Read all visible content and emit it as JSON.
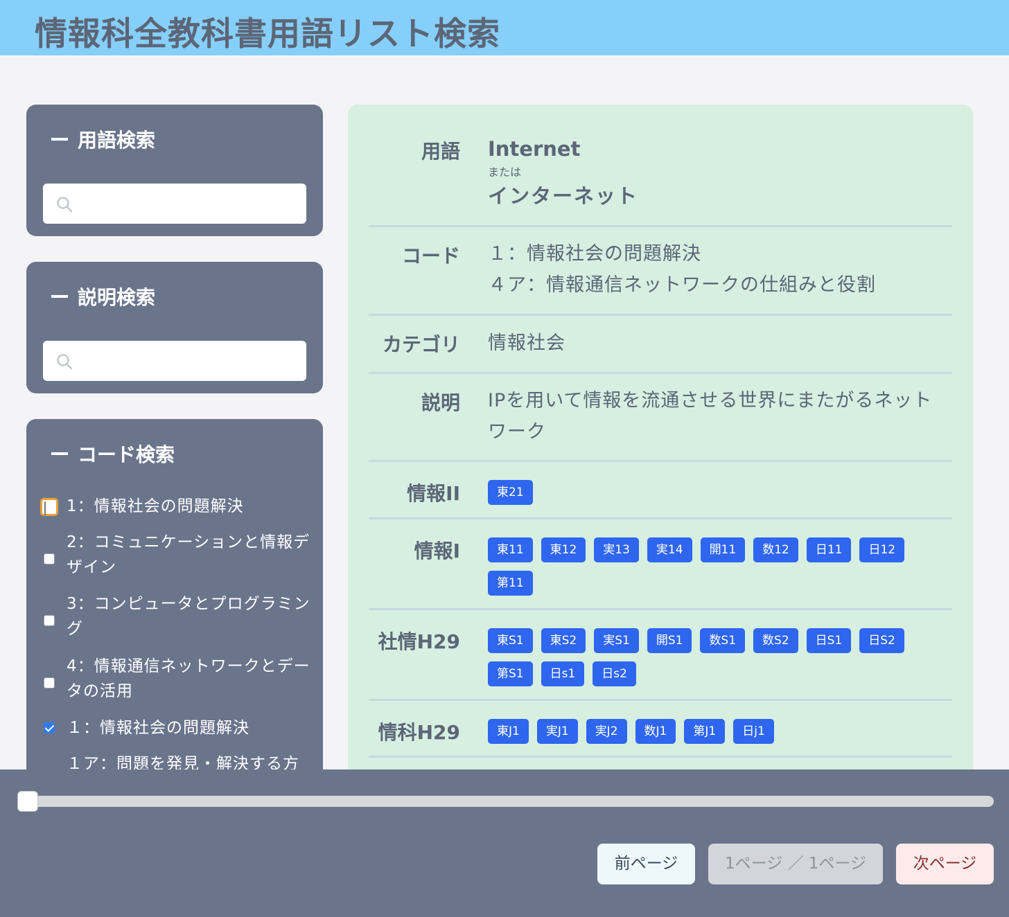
{
  "header": {
    "title": "情報科全教科書用語リスト検索"
  },
  "sidebar": {
    "term_search": {
      "title": "用語検索",
      "placeholder": ""
    },
    "desc_search": {
      "title": "説明検索",
      "placeholder": ""
    },
    "code_search": {
      "title": "コード検索",
      "items": [
        {
          "label": "1：情報社会の問題解決",
          "checked": false,
          "focused": true
        },
        {
          "label": "2：コミュニケーションと情報デザイン",
          "checked": false
        },
        {
          "label": "3：コンピュータとプログラミング",
          "checked": false
        },
        {
          "label": "4：情報通信ネットワークとデータの活用",
          "checked": false
        },
        {
          "label": "１：情報社会の問題解決",
          "checked": true
        },
        {
          "label": "１ア：問題を発見・解決する方",
          "checked": false
        }
      ]
    }
  },
  "detail": {
    "term": {
      "label": "用語",
      "primary": "Internet",
      "or": "または",
      "secondary": "インターネット"
    },
    "code": {
      "label": "コード",
      "lines": [
        "１：情報社会の問題解決",
        "４ア：情報通信ネットワークの仕組みと役割"
      ]
    },
    "category": {
      "label": "カテゴリ",
      "value": "情報社会"
    },
    "description": {
      "label": "説明",
      "value": "IPを用いて情報を流通させる世界にまたがるネットワーク"
    },
    "joho2": {
      "label": "情報II",
      "tags": [
        "東21"
      ]
    },
    "joho1": {
      "label": "情報I",
      "tags": [
        "東11",
        "東12",
        "実13",
        "実14",
        "開11",
        "数12",
        "日11",
        "日12",
        "第11"
      ]
    },
    "shajo": {
      "label": "社情H29",
      "tags": [
        "東S1",
        "東S2",
        "実S1",
        "開S1",
        "数S1",
        "数S2",
        "日S1",
        "日S2",
        "第S1",
        "日s1",
        "日s2"
      ]
    },
    "joka": {
      "label": "情科H29",
      "tags": [
        "東J1",
        "実J1",
        "実J2",
        "数J1",
        "第J1",
        "日j1"
      ]
    }
  },
  "footer": {
    "slider_value": 0,
    "prev_label": "前ページ",
    "page_label": "1ページ ／ 1ページ",
    "next_label": "次ページ"
  },
  "icons": {
    "search": "search-icon",
    "collapse": "minus-icon"
  },
  "colors": {
    "header": "#86cffa",
    "panel": "#6a758c",
    "detail": "#d6efe1",
    "tag": "#2f66f0"
  }
}
